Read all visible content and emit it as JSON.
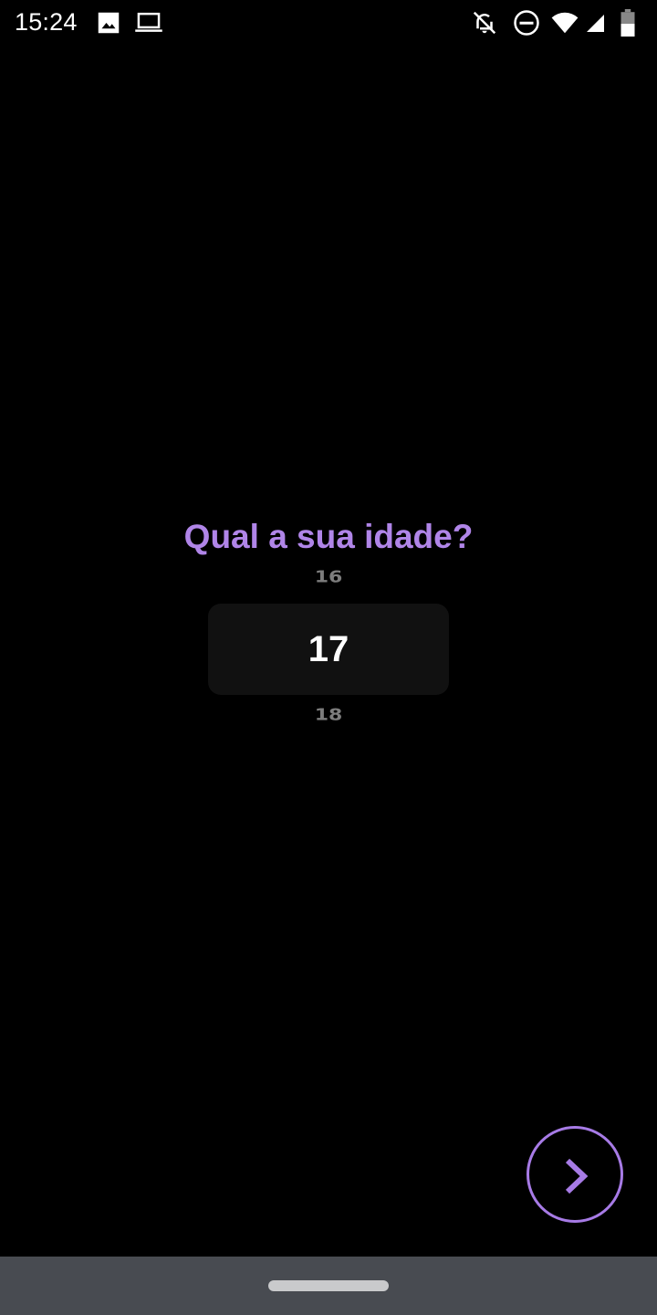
{
  "status_bar": {
    "time": "15:24",
    "icons": [
      "image-icon",
      "laptop-icon",
      "notifications-off-icon",
      "do-not-disturb-icon",
      "wifi-icon",
      "cellular-signal-icon",
      "battery-icon"
    ]
  },
  "screen": {
    "question": "Qual a sua idade?",
    "picker": {
      "previous": "16",
      "selected": "17",
      "next": "18"
    },
    "next_button_icon": "chevron-right-icon"
  },
  "colors": {
    "background": "#000000",
    "accent": "#b085e8",
    "picker_box": "#111111",
    "nav_bar": "#484b51"
  }
}
